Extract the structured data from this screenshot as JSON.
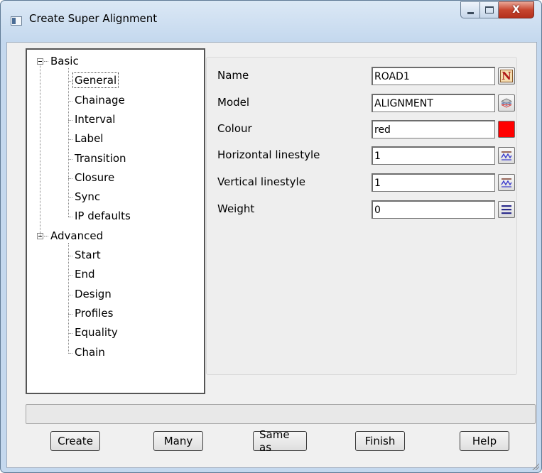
{
  "window": {
    "title": "Create Super Alignment",
    "controls": [
      "minimize",
      "maximize",
      "close"
    ]
  },
  "tree": {
    "groups": [
      {
        "label": "Basic",
        "children": [
          "General",
          "Chainage",
          "Interval",
          "Label",
          "Transition",
          "Closure",
          "Sync",
          "IP defaults"
        ]
      },
      {
        "label": "Advanced",
        "children": [
          "Start",
          "End",
          "Design",
          "Profiles",
          "Equality",
          "Chain"
        ]
      }
    ],
    "selected": "General"
  },
  "form": {
    "name_label": "Name",
    "name_value": "ROAD1",
    "model_label": "Model",
    "model_value": "ALIGNMENT",
    "colour_label": "Colour",
    "colour_value": "red",
    "colour_swatch": "#ff0000",
    "hlinestyle_label": "Horizontal linestyle",
    "hlinestyle_value": "1",
    "vlinestyle_label": "Vertical linestyle",
    "vlinestyle_value": "1",
    "weight_label": "Weight",
    "weight_value": "0"
  },
  "icons": {
    "name_button": "N",
    "model_button": "layers-icon",
    "colour_button": "color-swatch-icon",
    "hlinestyle_button": "linestyle-icon",
    "vlinestyle_button": "linestyle-icon",
    "weight_button": "weight-lines-icon"
  },
  "status_text": "",
  "buttons": {
    "create": "Create",
    "many": "Many",
    "same_as": "Same as",
    "finish": "Finish",
    "help": "Help"
  }
}
